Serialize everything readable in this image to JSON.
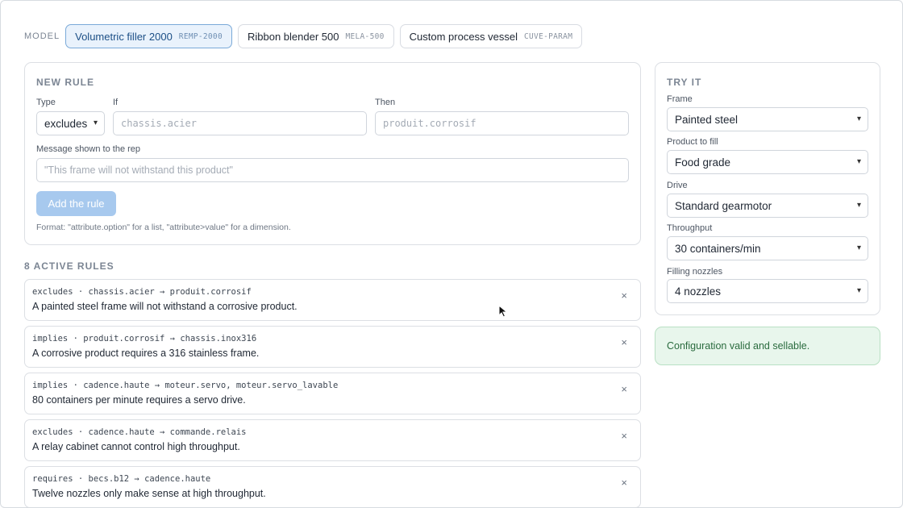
{
  "model_bar": {
    "label": "MODEL",
    "models": [
      {
        "name": "Volumetric filler 2000",
        "code": "REMP-2000",
        "active": true
      },
      {
        "name": "Ribbon blender 500",
        "code": "MELA-500",
        "active": false
      },
      {
        "name": "Custom process vessel",
        "code": "CUVE-PARAM",
        "active": false
      }
    ]
  },
  "new_rule": {
    "title": "NEW RULE",
    "type_label": "Type",
    "type_value": "excludes",
    "if_label": "If",
    "if_placeholder": "chassis.acier",
    "then_label": "Then",
    "then_placeholder": "produit.corrosif",
    "message_label": "Message shown to the rep",
    "message_placeholder": "\"This frame will not withstand this product\"",
    "add_button": "Add the rule",
    "hint": "Format: \"attribute.option\" for a list, \"attribute>value\" for a dimension."
  },
  "active_rules": {
    "title": "8 ACTIVE RULES",
    "close_glyph": "×",
    "items": [
      {
        "code": "excludes · chassis.acier → produit.corrosif",
        "message": "A painted steel frame will not withstand a corrosive product."
      },
      {
        "code": "implies · produit.corrosif → chassis.inox316",
        "message": "A corrosive product requires a 316 stainless frame."
      },
      {
        "code": "implies · cadence.haute → moteur.servo, moteur.servo_lavable",
        "message": "80 containers per minute requires a servo drive."
      },
      {
        "code": "excludes · cadence.haute → commande.relais",
        "message": "A relay cabinet cannot control high throughput."
      },
      {
        "code": "requires · becs.b12 → cadence.haute",
        "message": "Twelve nozzles only make sense at high throughput."
      }
    ]
  },
  "try_it": {
    "title": "TRY IT",
    "fields": [
      {
        "label": "Frame",
        "value": "Painted steel"
      },
      {
        "label": "Product to fill",
        "value": "Food grade"
      },
      {
        "label": "Drive",
        "value": "Standard gearmotor"
      },
      {
        "label": "Throughput",
        "value": "30 containers/min"
      },
      {
        "label": "Filling nozzles",
        "value": "4 nozzles"
      }
    ]
  },
  "status": {
    "message": "Configuration valid and sellable.",
    "color": "#2a6b3e"
  },
  "colors": {
    "accent": "#1c4f86",
    "button_disabled": "#a7c9ee",
    "success_bg": "#e8f6ec"
  }
}
